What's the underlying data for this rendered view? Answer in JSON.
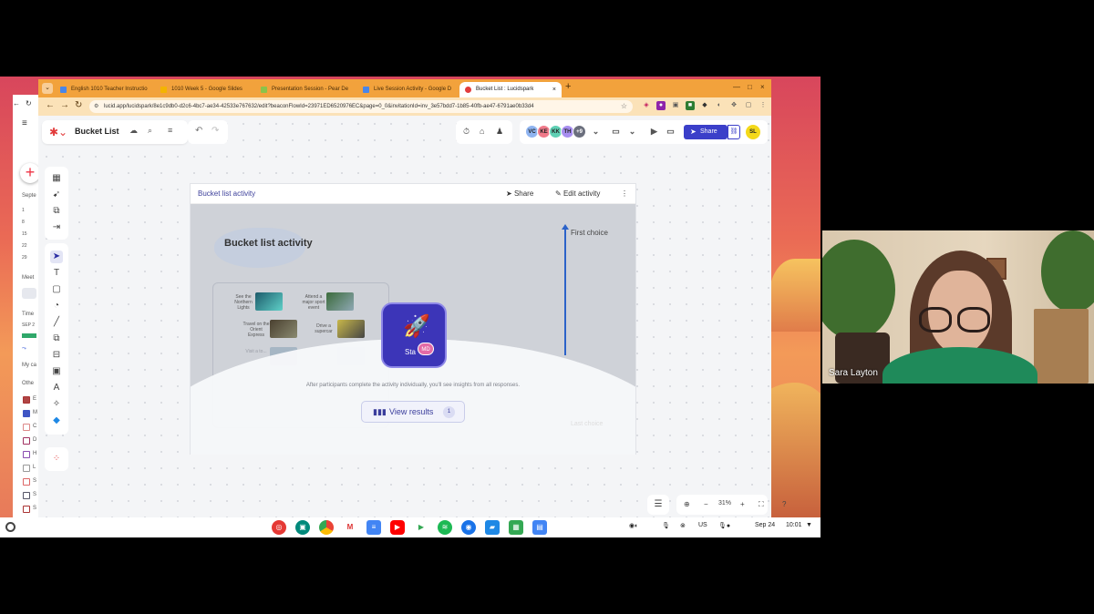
{
  "browser": {
    "tabs": [
      {
        "label": "English 1010 Teacher Instructio",
        "favicon_color": "#4a86e8"
      },
      {
        "label": "1010 Week 5 - Google Slides",
        "favicon_color": "#f4b400"
      },
      {
        "label": "Presentation Session - Pear De",
        "favicon_color": "#8bc34a"
      },
      {
        "label": "Live Session Activity - Google D",
        "favicon_color": "#4a86e8"
      },
      {
        "label": "Bucket List : Lucidspark",
        "favicon_color": "#e23c3c"
      }
    ],
    "active_tab_index": 4,
    "url": "lucid.app/lucidspark/8e1c9db0-d2c6-4bc7-ae34-42533e767632/edit?beaconFlowId=23971ED6520976EC&page=0_0&invitationId=inv_3e57bdd7-1b85-40fb-ae47-6791ae0b33d4"
  },
  "calendar": {
    "month": "Septe",
    "days": [
      "1",
      "8",
      "15",
      "22",
      "29"
    ],
    "meet": "Meet",
    "time": "Time",
    "date_tag": "SEP 2",
    "my_cal": "My ca",
    "other": "Othe",
    "letters": [
      "E",
      "M",
      "C",
      "D",
      "H",
      "L",
      "S",
      "S",
      "S"
    ]
  },
  "lucid": {
    "board_title": "Bucket List",
    "collaborators": [
      {
        "initials": "VC",
        "color": "#8fb4f0"
      },
      {
        "initials": "KE",
        "color": "#f07a8a"
      },
      {
        "initials": "KK",
        "color": "#5fd0b4"
      },
      {
        "initials": "TH",
        "color": "#a78ef0"
      },
      {
        "initials": "+9",
        "color": "#6b6f7d"
      }
    ],
    "share_label": "Share",
    "me_initials": "SL",
    "zoom": "31%"
  },
  "activity": {
    "header_title": "Bucket list activity",
    "share_label": "Share",
    "edit_label": "Edit activity",
    "board_title": "Bucket list activity",
    "cards": [
      {
        "text": "See the Northern Lights"
      },
      {
        "text": "Attend a major sport event"
      },
      {
        "text": "Travel on the Orient Express"
      },
      {
        "text": "Drive a supercar"
      },
      {
        "text": "Visit a to...",
        "faded": true
      }
    ],
    "axis_top": "First choice",
    "axis_bottom": "Last choice",
    "start_label": "Sta",
    "start_user": "MD",
    "message": "After participants complete the activity individually, you'll see insights from all responses.",
    "view_results_label": "View results",
    "results_count": "1"
  },
  "shelf": {
    "date": "Sep 24",
    "time": "10:01",
    "lang": "US"
  },
  "video": {
    "participant_name": "Sara Layton"
  }
}
